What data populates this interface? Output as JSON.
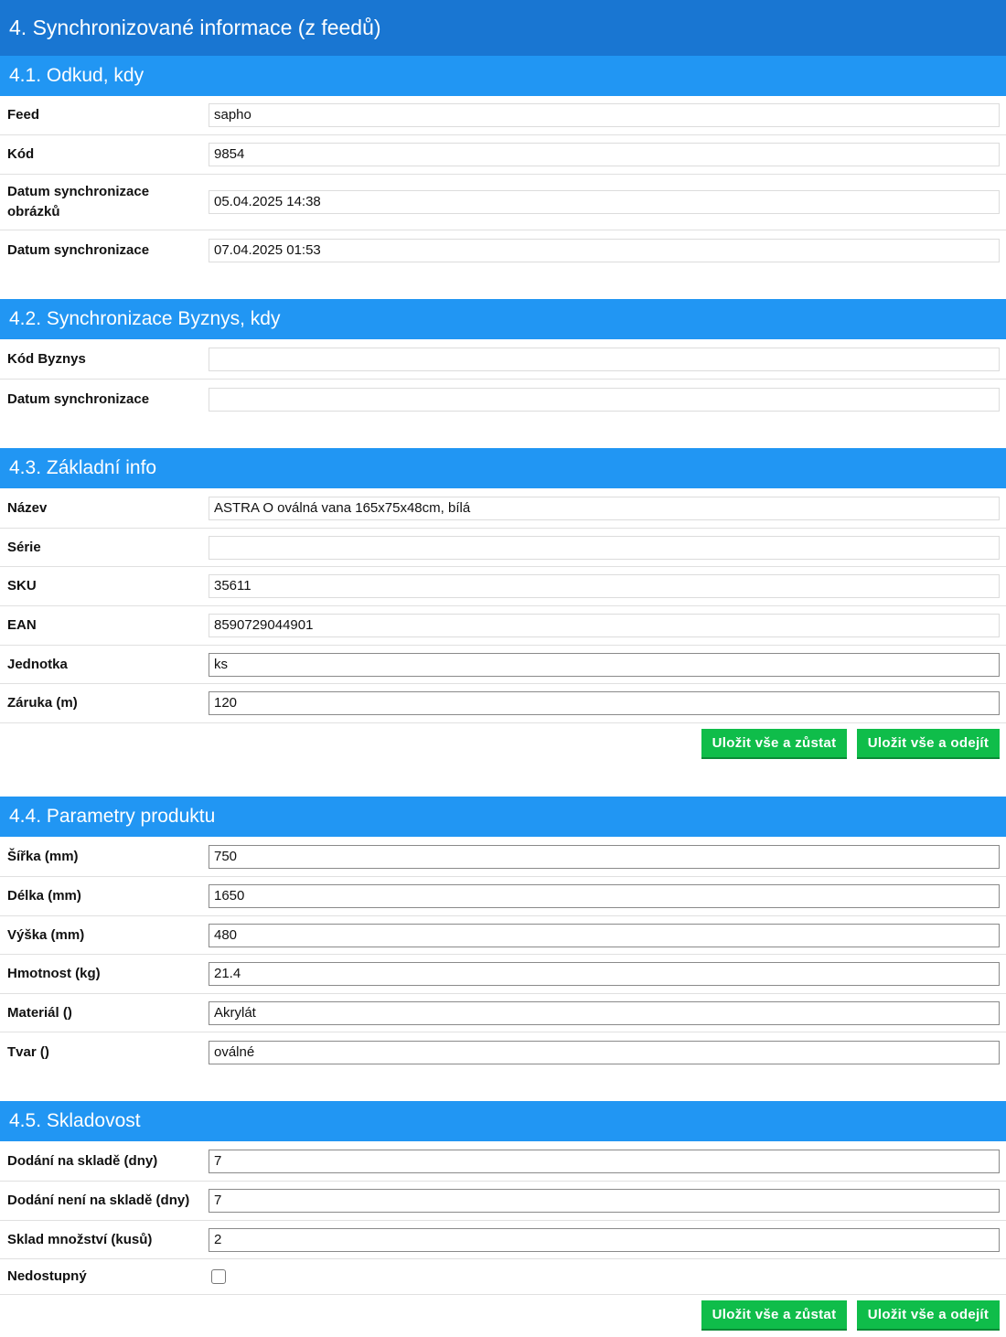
{
  "main_title": "4. Synchronizované informace (z feedů)",
  "save_stay_label": "Uložit vše a zůstat",
  "save_leave_label": "Uložit vše a odejít",
  "sections": [
    {
      "title": "4.1. Odkud, kdy",
      "rows": [
        {
          "label": "Feed",
          "value": "sapho"
        },
        {
          "label": "Kód",
          "value": "9854"
        },
        {
          "label": "Datum synchronizace obrázků",
          "value": "05.04.2025 14:38"
        },
        {
          "label": "Datum synchronizace",
          "value": "07.04.2025 01:53"
        }
      ]
    },
    {
      "title": "4.2. Synchronizace Byznys, kdy",
      "rows": [
        {
          "label": "Kód Byznys",
          "value": ""
        },
        {
          "label": "Datum synchronizace",
          "value": ""
        }
      ]
    },
    {
      "title": "4.3. Základní info",
      "rows": [
        {
          "label": "Název",
          "value": "ASTRA O oválná vana 165x75x48cm, bílá"
        },
        {
          "label": "Série",
          "value": ""
        },
        {
          "label": "SKU",
          "value": "35611"
        },
        {
          "label": "EAN",
          "value": "8590729044901"
        },
        {
          "label": "Jednotka",
          "value": "ks"
        },
        {
          "label": "Záruka (m)",
          "value": "120"
        }
      ]
    },
    {
      "title": "4.4. Parametry produktu",
      "rows": [
        {
          "label": "Šířka (mm)",
          "value": "750"
        },
        {
          "label": "Délka (mm)",
          "value": "1650"
        },
        {
          "label": "Výška (mm)",
          "value": "480"
        },
        {
          "label": "Hmotnost (kg)",
          "value": "21.4"
        },
        {
          "label": "Materiál ()",
          "value": "Akrylát"
        },
        {
          "label": "Tvar ()",
          "value": "oválné"
        }
      ]
    },
    {
      "title": "4.5. Skladovost",
      "rows": [
        {
          "label": "Dodání na skladě (dny)",
          "value": "7"
        },
        {
          "label": "Dodání není na skladě (dny)",
          "value": "7"
        },
        {
          "label": "Sklad množství (kusů)",
          "value": "2"
        },
        {
          "label": "Nedostupný",
          "checked": false
        }
      ]
    }
  ]
}
